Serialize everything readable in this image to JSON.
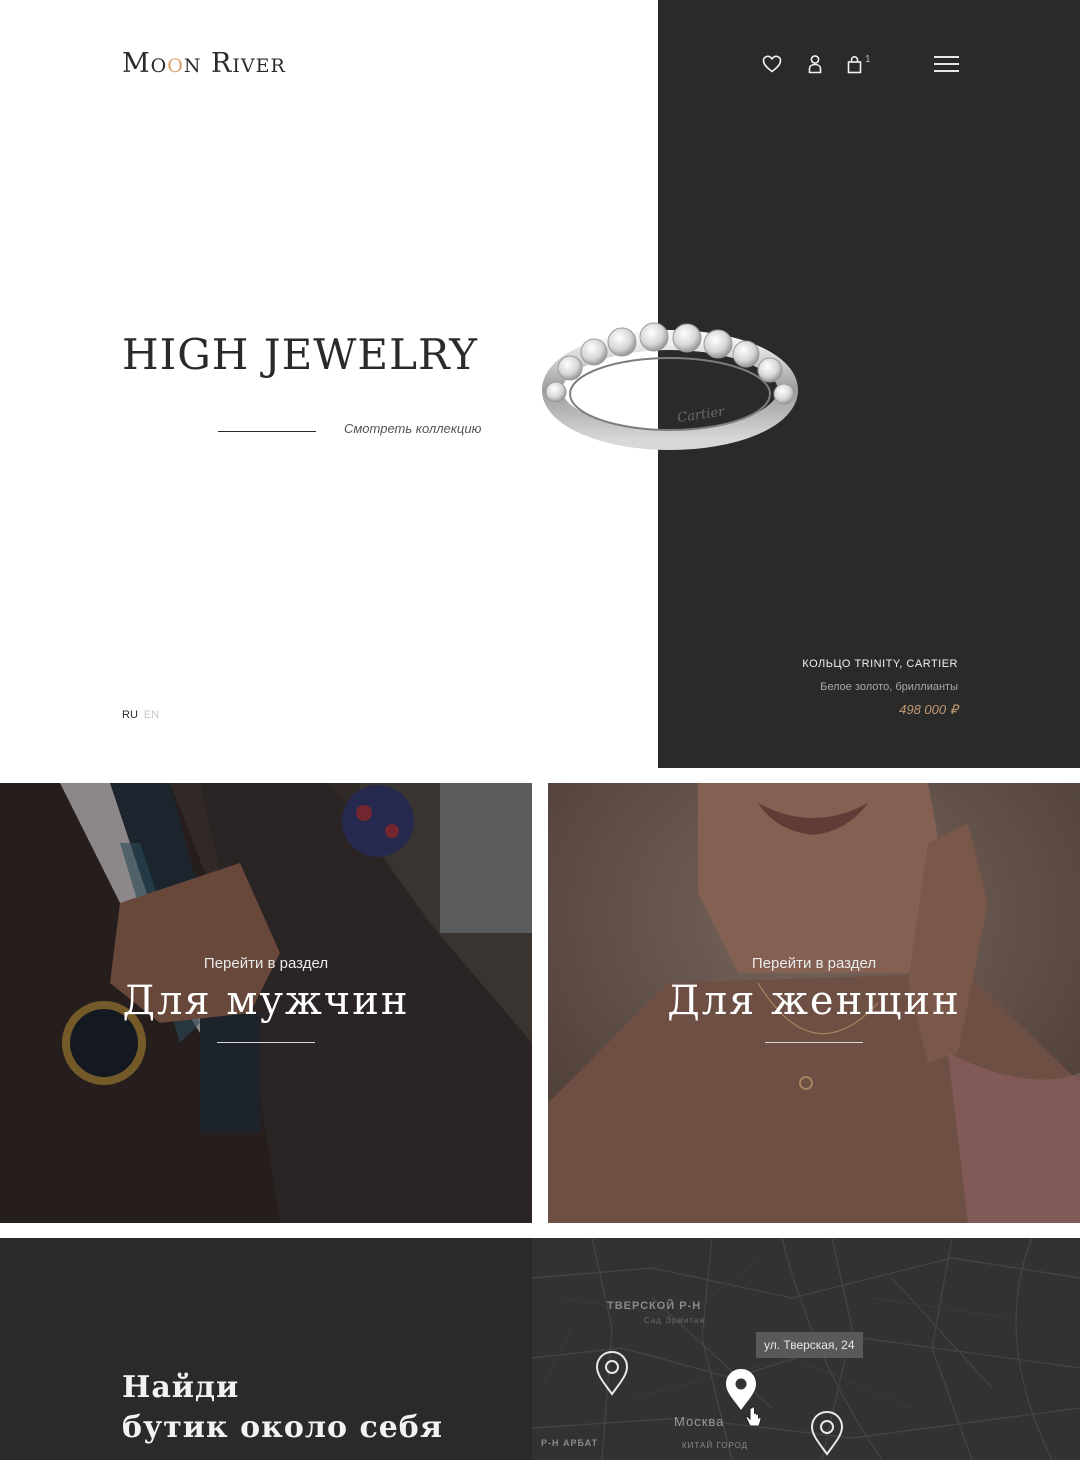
{
  "header": {
    "logo_part1": "Mo",
    "logo_o_accent": "o",
    "logo_part2": "n River",
    "icons": [
      "heart-icon",
      "user-icon",
      "bag-icon",
      "menu-icon"
    ],
    "cart_count": "1"
  },
  "hero": {
    "title": "HIGH JEWELRY",
    "collection_link": "Смотреть коллекцию",
    "languages": {
      "active": "RU",
      "inactive": "EN"
    },
    "product": {
      "name": "КОЛЬЦО TRINITY, CARTIER",
      "description": "Белое золото, бриллианты",
      "price": "498 000 ₽",
      "engraving": "Cartier"
    }
  },
  "categories": {
    "men": {
      "subtitle": "Перейти в раздел",
      "title": "Для мужчин"
    },
    "women": {
      "subtitle": "Перейти в раздел",
      "title": "Для женщин"
    }
  },
  "stores": {
    "title_line1": "Найди",
    "title_line2": "бутик около себя",
    "map": {
      "district1": "ТВЕРСКОЙ Р-Н",
      "place1": "Сад Эрмитаж",
      "city": "Москва",
      "district2": "Р-Н АРБАТ",
      "district3": "КИТАЙ ГОРОД",
      "tooltip": "ул. Тверская, 24"
    }
  },
  "colors": {
    "dark": "#2a2a2a",
    "accent_gold": "#c09a72",
    "logo_accent": "#d9a066"
  }
}
